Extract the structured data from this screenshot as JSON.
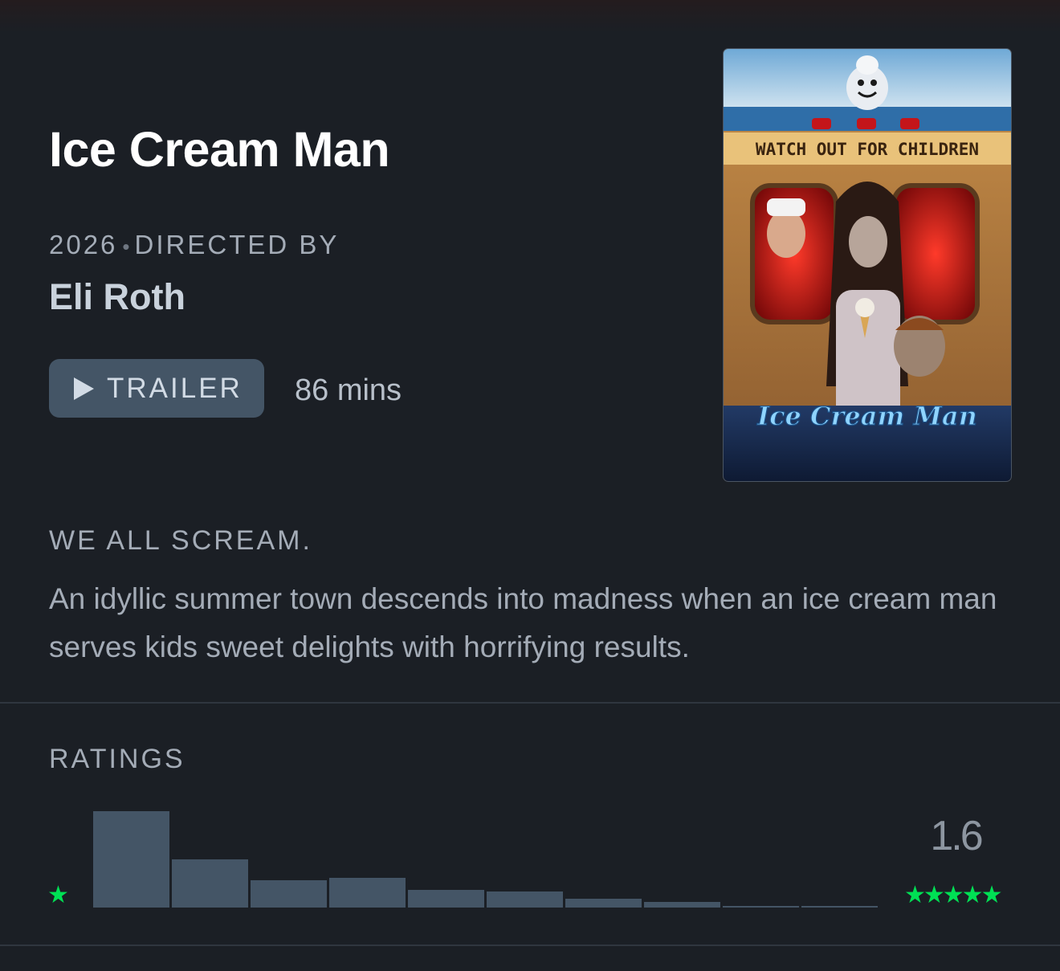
{
  "film": {
    "title": "Ice Cream Man",
    "year": "2026",
    "directed_by_label": "DIRECTED BY",
    "director": "Eli Roth",
    "trailer_label": "TRAILER",
    "runtime": "86 mins",
    "tagline": "WE ALL SCREAM.",
    "synopsis": "An idyllic summer town descends into madness when an ice cream man serves kids sweet delights with horrifying results."
  },
  "poster": {
    "banner_text": "WATCH OUT FOR CHILDREN",
    "logo_text": "Ice Cream Man"
  },
  "ratings": {
    "heading": "RATINGS",
    "average": "1.6",
    "min_label": "★",
    "max_label": "★★★★★",
    "histogram": [
      1.0,
      0.5,
      0.28,
      0.31,
      0.18,
      0.17,
      0.09,
      0.06,
      0.02,
      0.02
    ]
  },
  "colors": {
    "background": "#1b1f25",
    "accent_green": "#00e054",
    "button": "#445566",
    "bar": "#445566"
  }
}
